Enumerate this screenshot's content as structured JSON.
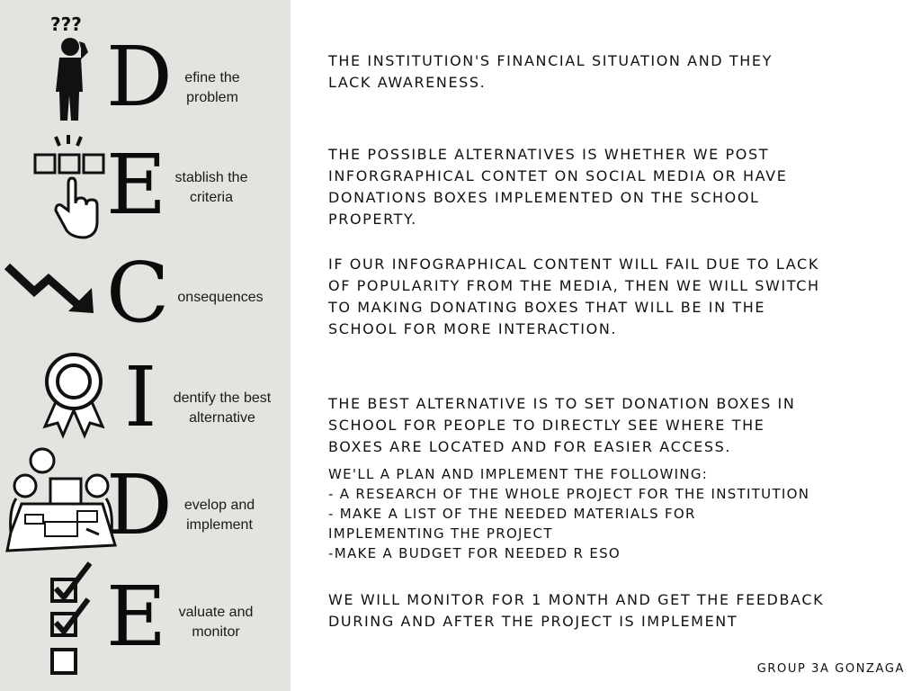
{
  "steps": [
    {
      "letter": "D",
      "label": "efine the\nproblem",
      "icon": "confused-person-icon"
    },
    {
      "letter": "E",
      "label": "stablish the\ncriteria",
      "icon": "hand-select-option-icon"
    },
    {
      "letter": "C",
      "label": "onsequences",
      "icon": "downtrend-arrow-icon"
    },
    {
      "letter": "I",
      "label": "dentify the best\nalternative",
      "icon": "award-rosette-icon"
    },
    {
      "letter": "D",
      "label": "evelop and\nimplement",
      "icon": "team-meeting-icon"
    },
    {
      "letter": "E",
      "label": "valuate and\nmonitor",
      "icon": "checklist-icon"
    }
  ],
  "paragraphs": {
    "define": "THE INSTITUTION'S FINANCIAL SITUATION  AND THEY\nLACK AWARENESS.",
    "criteria": "THE POSSIBLE ALTERNATIVES IS WHETHER WE POST\nINFORGRAPHICAL CONTET ON SOCIAL MEDIA OR HAVE\nDONATIONS BOXES IMPLEMENTED ON THE SCHOOL\nPROPERTY.",
    "consequences": "IF OUR INFOGRAPHICAL CONTENT WILL FAIL DUE TO LACK\nOF POPULARITY FROM THE MEDIA, THEN WE WILL SWITCH\nTO MAKING DONATING BOXES THAT WILL BE IN THE\nSCHOOL FOR MORE INTERACTION.",
    "identify": "THE BEST ALTERNATIVE IS TO SET DONATION BOXES IN\nSCHOOL FOR PEOPLE TO DIRECTLY SEE WHERE THE\nBOXES ARE LOCATED AND FOR EASIER ACCESS.",
    "develop": "WE'LL A PLAN AND IMPLEMENT THE FOLLOWING:\n- A RESEARCH OF THE WHOLE PROJECT FOR THE INSTITUTION\n - MAKE A LIST OF THE NEEDED MATERIALS FOR\nIMPLEMENTING THE PROJECT\n-MAKE A BUDGET FOR NEEDED R ESO",
    "evaluate": "WE WILL MONITOR FOR 1 MONTH AND GET THE FEEDBACK\nDURING AND AFTER THE PROJECT IS IMPLEMENT"
  },
  "footer": "GROUP 3A GONZAGA",
  "colors": {
    "sidebar_bg": "#e3e3df",
    "ink": "#111111"
  }
}
